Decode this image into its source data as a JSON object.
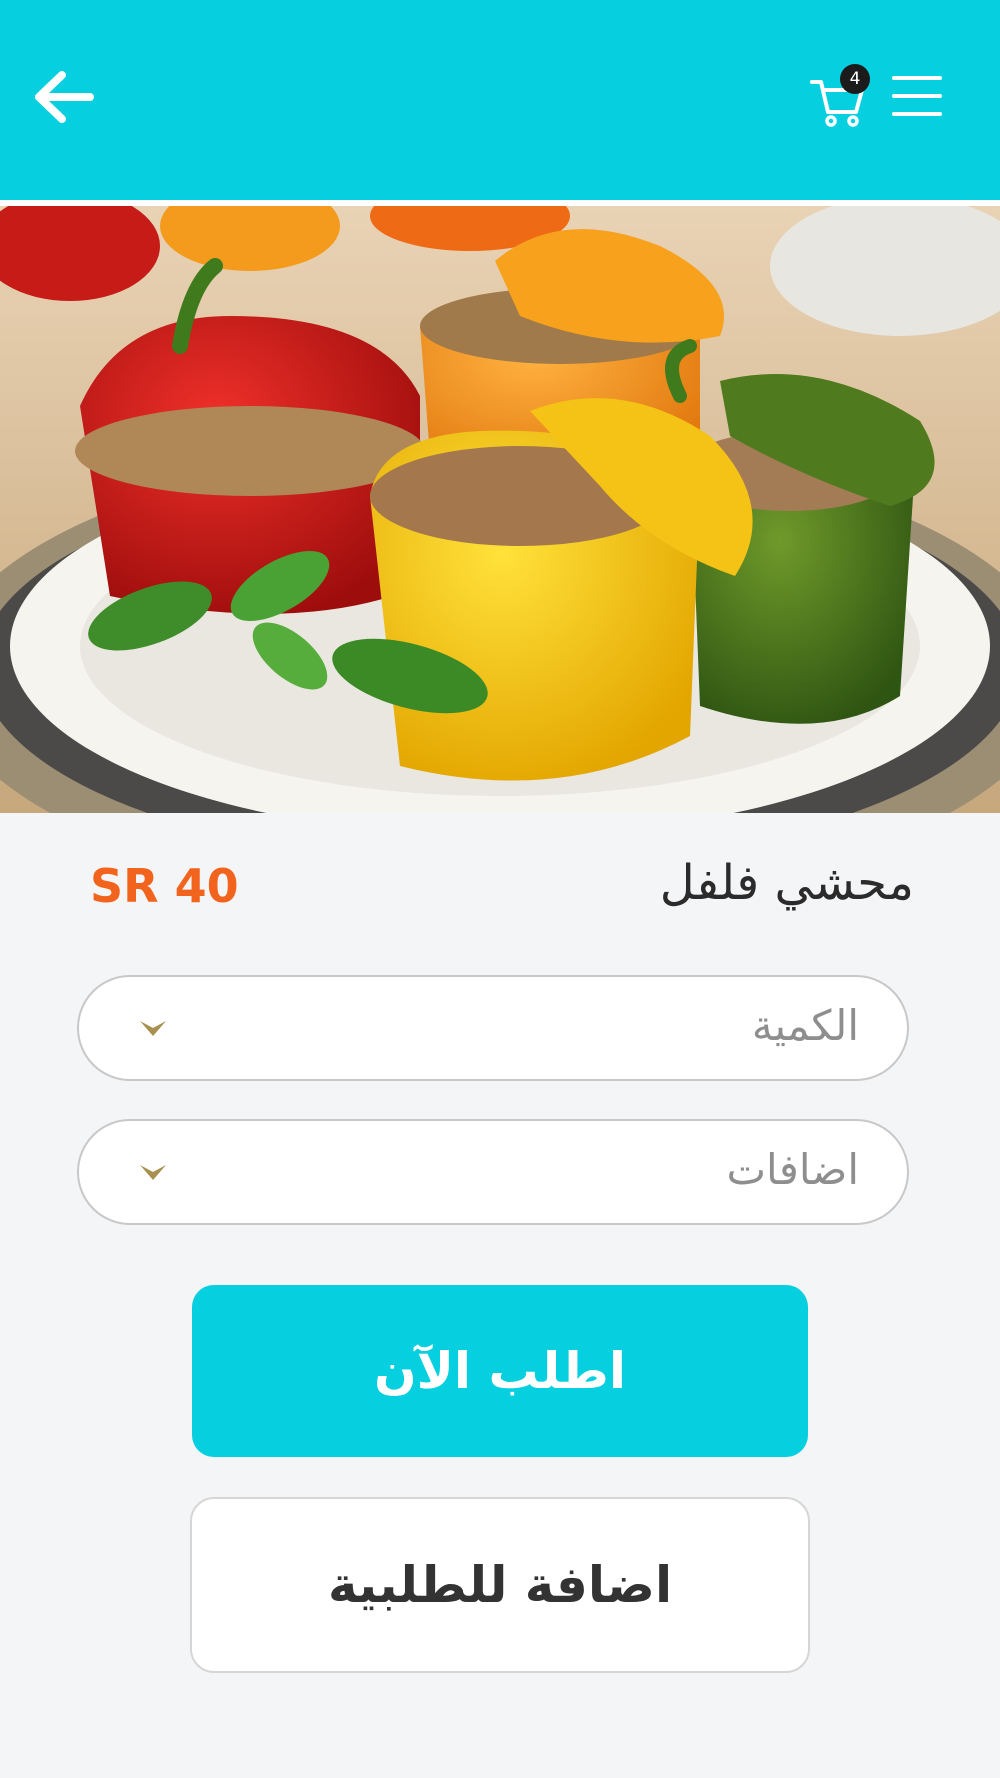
{
  "header": {
    "back_icon": "arrow-left-icon",
    "menu_icon": "hamburger-menu-icon",
    "cart_icon": "shopping-cart-icon",
    "cart_count": "4",
    "background_color": "#06cfe0"
  },
  "product": {
    "name": "محشي فلفل",
    "price": "SR 40",
    "price_color": "#f2641e",
    "image_description_icon": "food-photo"
  },
  "options": {
    "quantity_label": "الكمية",
    "extras_label": "اضافات",
    "chevron_color": "#a8904f"
  },
  "actions": {
    "order_now": "اطلب الآن",
    "add_to_order": "اضافة للطلبية"
  }
}
